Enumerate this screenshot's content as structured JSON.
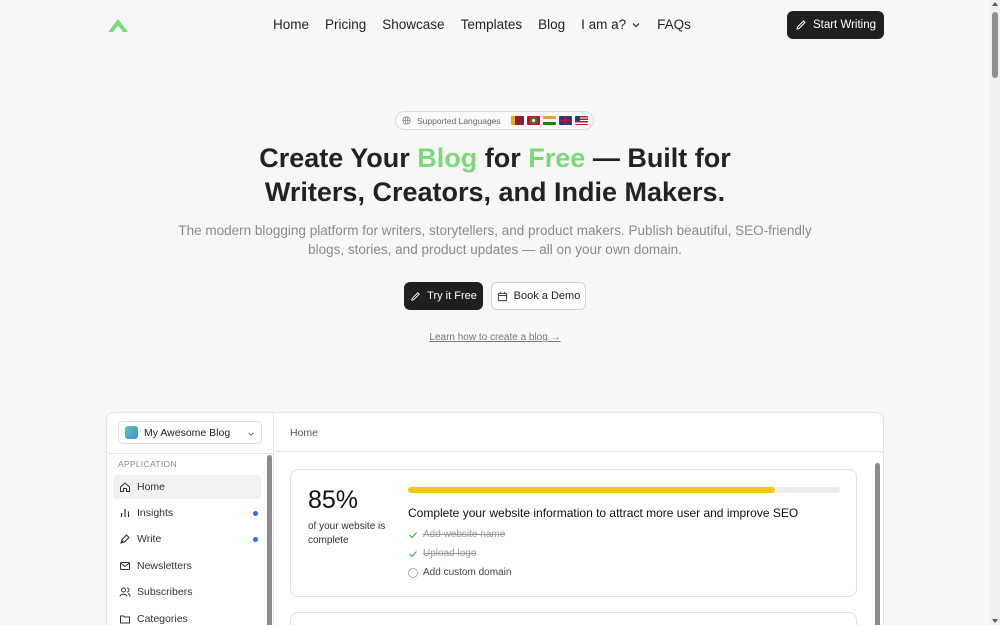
{
  "nav": {
    "links": [
      "Home",
      "Pricing",
      "Showcase",
      "Templates",
      "Blog",
      "I am a?",
      "FAQs"
    ],
    "cta": "Start Writing"
  },
  "hero": {
    "languages_label": "Supported Languages",
    "flags": [
      "sri-lanka-flag",
      "maldives-flag",
      "india-flag",
      "uk-flag",
      "us-flag"
    ],
    "headline_1_a": "Create Your ",
    "headline_1_b": "Blog",
    "headline_1_c": " for ",
    "headline_1_d": "Free",
    "headline_1_e": " — Built for",
    "headline_2": "Writers, Creators, and Indie Makers.",
    "sub_1": "The modern blogging platform for writers, storytellers, and product makers. Publish beautiful, SEO-friendly",
    "sub_2": "blogs, stories, and product updates — all on your own domain.",
    "try_label": "Try it Free",
    "demo_label": "Book a Demo",
    "learn_link": "Learn how to create a blog →"
  },
  "app": {
    "blog_name": "My Awesome Blog",
    "section_label": "APPLICATION",
    "sidebar_items": [
      "Home",
      "Insights",
      "Write",
      "Newsletters",
      "Subscribers",
      "Categories"
    ],
    "breadcrumb": "Home",
    "progress": {
      "percent_label": "85%",
      "percent_value": 0.85,
      "desc": "of your website is complete",
      "title": "Complete your website information to attract more user and improve SEO",
      "tasks": [
        "Add website name",
        "Upload logo",
        "Add custom domain"
      ]
    }
  },
  "colors": {
    "accent_green": "#7dd87a",
    "progress_yellow": "#f2c717",
    "dark_button": "#1f1f1f",
    "notify_blue": "#2f6fe0"
  }
}
